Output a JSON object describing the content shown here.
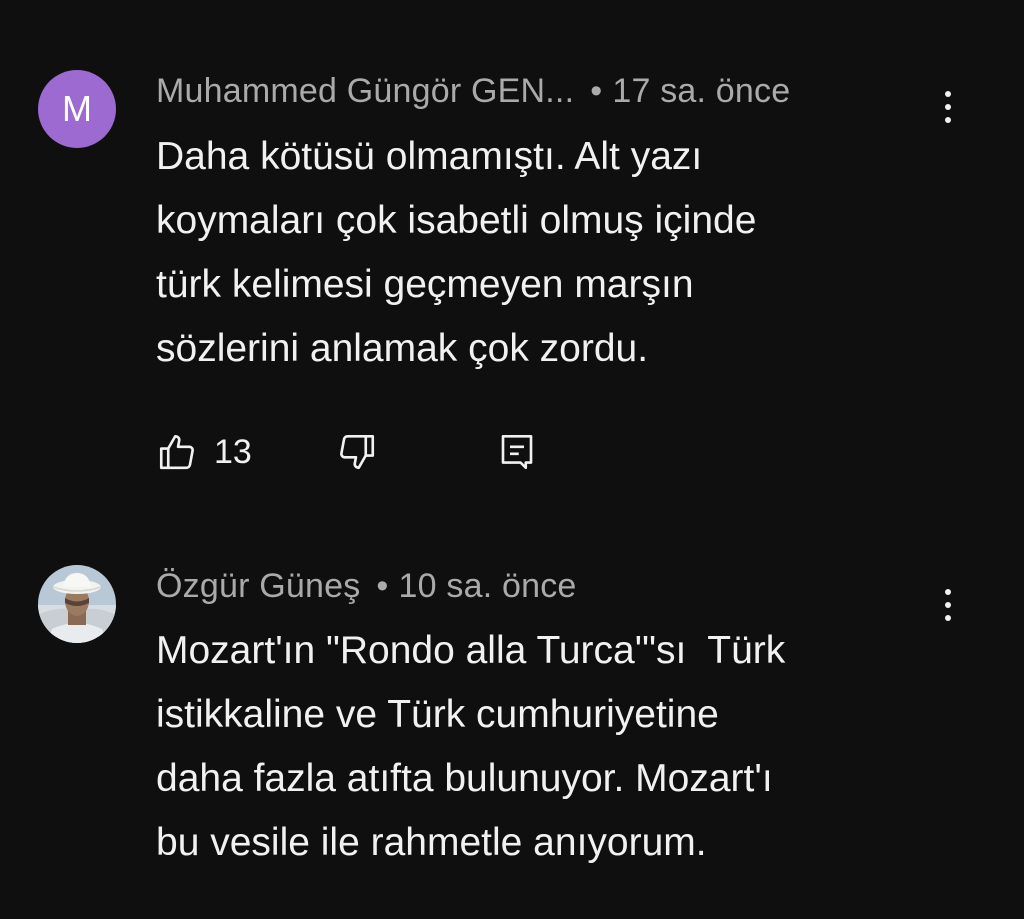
{
  "comments": [
    {
      "avatar_letter": "M",
      "avatar_color": "#9c6ad0",
      "author": "Muhammed Güngör GEN...",
      "separator": "•",
      "time": "17 sa. önce",
      "lines": [
        "Daha kötüsü olmamıştı. Alt yazı",
        "koymaları çok isabetli olmuş içinde",
        "türk kelimesi geçmeyen marşın",
        "sözlerini anlamak çok zordu."
      ],
      "like_count": "13",
      "icons": [
        "like-icon",
        "dislike-icon",
        "reply-icon",
        "more-vert-icon"
      ]
    },
    {
      "avatar_type": "photo",
      "author": "Özgür Güneş",
      "separator": "•",
      "time": "10 sa. önce",
      "lines": [
        "Mozart'ın \"Rondo alla Turca'\"sı  Türk",
        "istikkaline ve Türk cumhuriyetine",
        "daha fazla atıfta bulunuyor. Mozart'ı",
        "bu vesile ile rahmetle anıyorum."
      ],
      "icons": [
        "more-vert-icon"
      ]
    }
  ],
  "colors": {
    "background": "#0f0f0f",
    "text": "#f1f1f1",
    "meta": "#aaaaaa",
    "avatar_m": "#9c6ad0"
  }
}
